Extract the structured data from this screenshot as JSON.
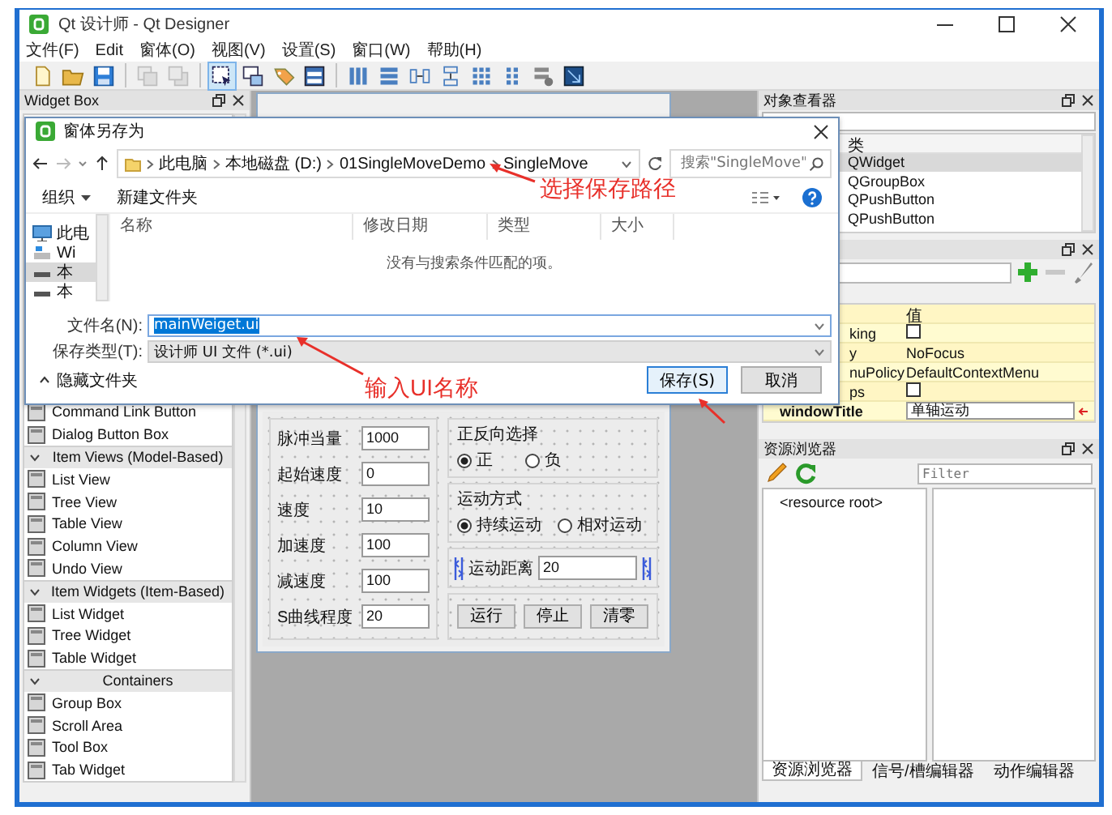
{
  "window": {
    "title": "Qt 设计师 - Qt Designer"
  },
  "menu": [
    "文件(F)",
    "Edit",
    "窗体(O)",
    "视图(V)",
    "设置(S)",
    "窗口(W)",
    "帮助(H)"
  ],
  "toolbar": [
    {
      "kind": "new",
      "on": false,
      "disabled": false
    },
    {
      "kind": "open",
      "on": false,
      "disabled": false
    },
    {
      "kind": "save",
      "on": false,
      "disabled": false
    },
    {
      "kind": "sep"
    },
    {
      "kind": "back",
      "on": false,
      "disabled": true
    },
    {
      "kind": "front",
      "on": false,
      "disabled": true
    },
    {
      "kind": "sep"
    },
    {
      "kind": "edit_widgets",
      "on": true,
      "disabled": false
    },
    {
      "kind": "edit_signals",
      "on": false,
      "disabled": false
    },
    {
      "kind": "edit_buddies",
      "on": false,
      "disabled": false
    },
    {
      "kind": "edit_tab_order",
      "on": false,
      "disabled": false
    },
    {
      "kind": "sep"
    },
    {
      "kind": "lay_h",
      "on": false,
      "disabled": false
    },
    {
      "kind": "lay_v",
      "on": false,
      "disabled": false
    },
    {
      "kind": "split_h",
      "on": false,
      "disabled": false
    },
    {
      "kind": "split_v",
      "on": false,
      "disabled": false
    },
    {
      "kind": "grid",
      "on": false,
      "disabled": false
    },
    {
      "kind": "form",
      "on": false,
      "disabled": false
    },
    {
      "kind": "break",
      "on": false,
      "disabled": false
    },
    {
      "kind": "adjust",
      "on": false,
      "disabled": false
    }
  ],
  "widget_box": {
    "title": "Widget Box",
    "items": [
      {
        "kind": "item",
        "label": "Command Link Button"
      },
      {
        "kind": "item",
        "label": "Dialog Button Box"
      },
      {
        "kind": "category",
        "label": "Item Views (Model-Based)",
        "expanded": true
      },
      {
        "kind": "item",
        "label": "List View"
      },
      {
        "kind": "item",
        "label": "Tree View"
      },
      {
        "kind": "item",
        "label": "Table View"
      },
      {
        "kind": "item",
        "label": "Column View"
      },
      {
        "kind": "item",
        "label": "Undo View"
      },
      {
        "kind": "category",
        "label": "Item Widgets (Item-Based)",
        "expanded": true
      },
      {
        "kind": "item",
        "label": "List Widget"
      },
      {
        "kind": "item",
        "label": "Tree Widget"
      },
      {
        "kind": "item",
        "label": "Table Widget"
      },
      {
        "kind": "category",
        "label": "Containers",
        "expanded": true
      },
      {
        "kind": "item",
        "label": "Group Box"
      },
      {
        "kind": "item",
        "label": "Scroll Area"
      },
      {
        "kind": "item",
        "label": "Tool Box"
      },
      {
        "kind": "item",
        "label": "Tab Widget"
      }
    ]
  },
  "form": {
    "params": [
      {
        "label": "脉冲当量",
        "value": "1000"
      },
      {
        "label": "起始速度",
        "value": "0"
      },
      {
        "label": "速度",
        "value": "10"
      },
      {
        "label": "加速度",
        "value": "100"
      },
      {
        "label": "减速度",
        "value": "100"
      },
      {
        "label": "S曲线程度",
        "value": "20"
      }
    ],
    "direction": {
      "title": "正反向选择",
      "options": [
        {
          "label": "正",
          "selected": true
        },
        {
          "label": "负",
          "selected": false
        }
      ]
    },
    "mode": {
      "title": "运动方式",
      "options": [
        {
          "label": "持续运动",
          "selected": true
        },
        {
          "label": "相对运动",
          "selected": false
        }
      ]
    },
    "distance": {
      "label": "运动距离",
      "value": "20"
    },
    "buttons": [
      "运行",
      "停止",
      "清零"
    ]
  },
  "object_inspector": {
    "title": "对象查看器",
    "class_header": "类",
    "rows": [
      {
        "class": "QWidget",
        "selected": true
      },
      {
        "class": "QGroupBox",
        "selected": false
      },
      {
        "class": "QPushButton",
        "selected": false
      },
      {
        "class": "QPushButton",
        "selected": false
      }
    ]
  },
  "property_editor": {
    "value_header": "值",
    "rows": [
      {
        "name": "king",
        "kind": "check",
        "checked": false
      },
      {
        "name": "y",
        "kind": "text",
        "value": "NoFocus"
      },
      {
        "name": "nuPolicy",
        "kind": "text",
        "value": "DefaultContextMenu"
      },
      {
        "name": "ps",
        "kind": "check",
        "checked": false
      },
      {
        "name": "windowTitle",
        "kind": "edit",
        "value": "单轴运动"
      }
    ]
  },
  "resource_browser": {
    "title": "资源浏览器",
    "filter": {
      "placeholder": "Filter"
    },
    "tree": [
      "<resource root>"
    ],
    "tabs": [
      {
        "label": "资源浏览器",
        "selected": true
      },
      {
        "label": "信号/槽编辑器",
        "selected": false
      },
      {
        "label": "动作编辑器",
        "selected": false
      }
    ]
  },
  "dialog": {
    "title": "窗体另存为",
    "breadcrumb": [
      "此电脑",
      "本地磁盘 (D:)",
      "01SingleMoveDemo",
      "SingleMove"
    ],
    "search": {
      "placeholder": "搜索\"SingleMove\""
    },
    "organize": "组织",
    "new_folder": "新建文件夹",
    "nav": [
      {
        "kind": "computer",
        "label": "此电",
        "selected": false
      },
      {
        "kind": "system_drive",
        "label": "Wi",
        "selected": false
      },
      {
        "kind": "drive",
        "label": "本",
        "selected": true
      },
      {
        "kind": "drive",
        "label": "本",
        "selected": false
      }
    ],
    "columns": [
      "名称",
      "修改日期",
      "类型",
      "大小"
    ],
    "empty_message": "没有与搜索条件匹配的项。",
    "file_name": {
      "label": "文件名(N):",
      "value": "mainWeiget.ui",
      "highlighted": true
    },
    "file_type": {
      "label": "保存类型(T):",
      "value": "设计师 UI 文件 (*.ui)"
    },
    "hide_folders": "隐藏文件夹",
    "buttons": [
      {
        "label": "保存(S)",
        "default": true
      },
      {
        "label": "取消",
        "default": false
      }
    ]
  },
  "annotations": [
    {
      "kind": "labeled_arrow",
      "text": "选择保存路径"
    },
    {
      "kind": "labeled_arrow",
      "text": "输入UI名称"
    },
    {
      "kind": "arrow"
    }
  ]
}
